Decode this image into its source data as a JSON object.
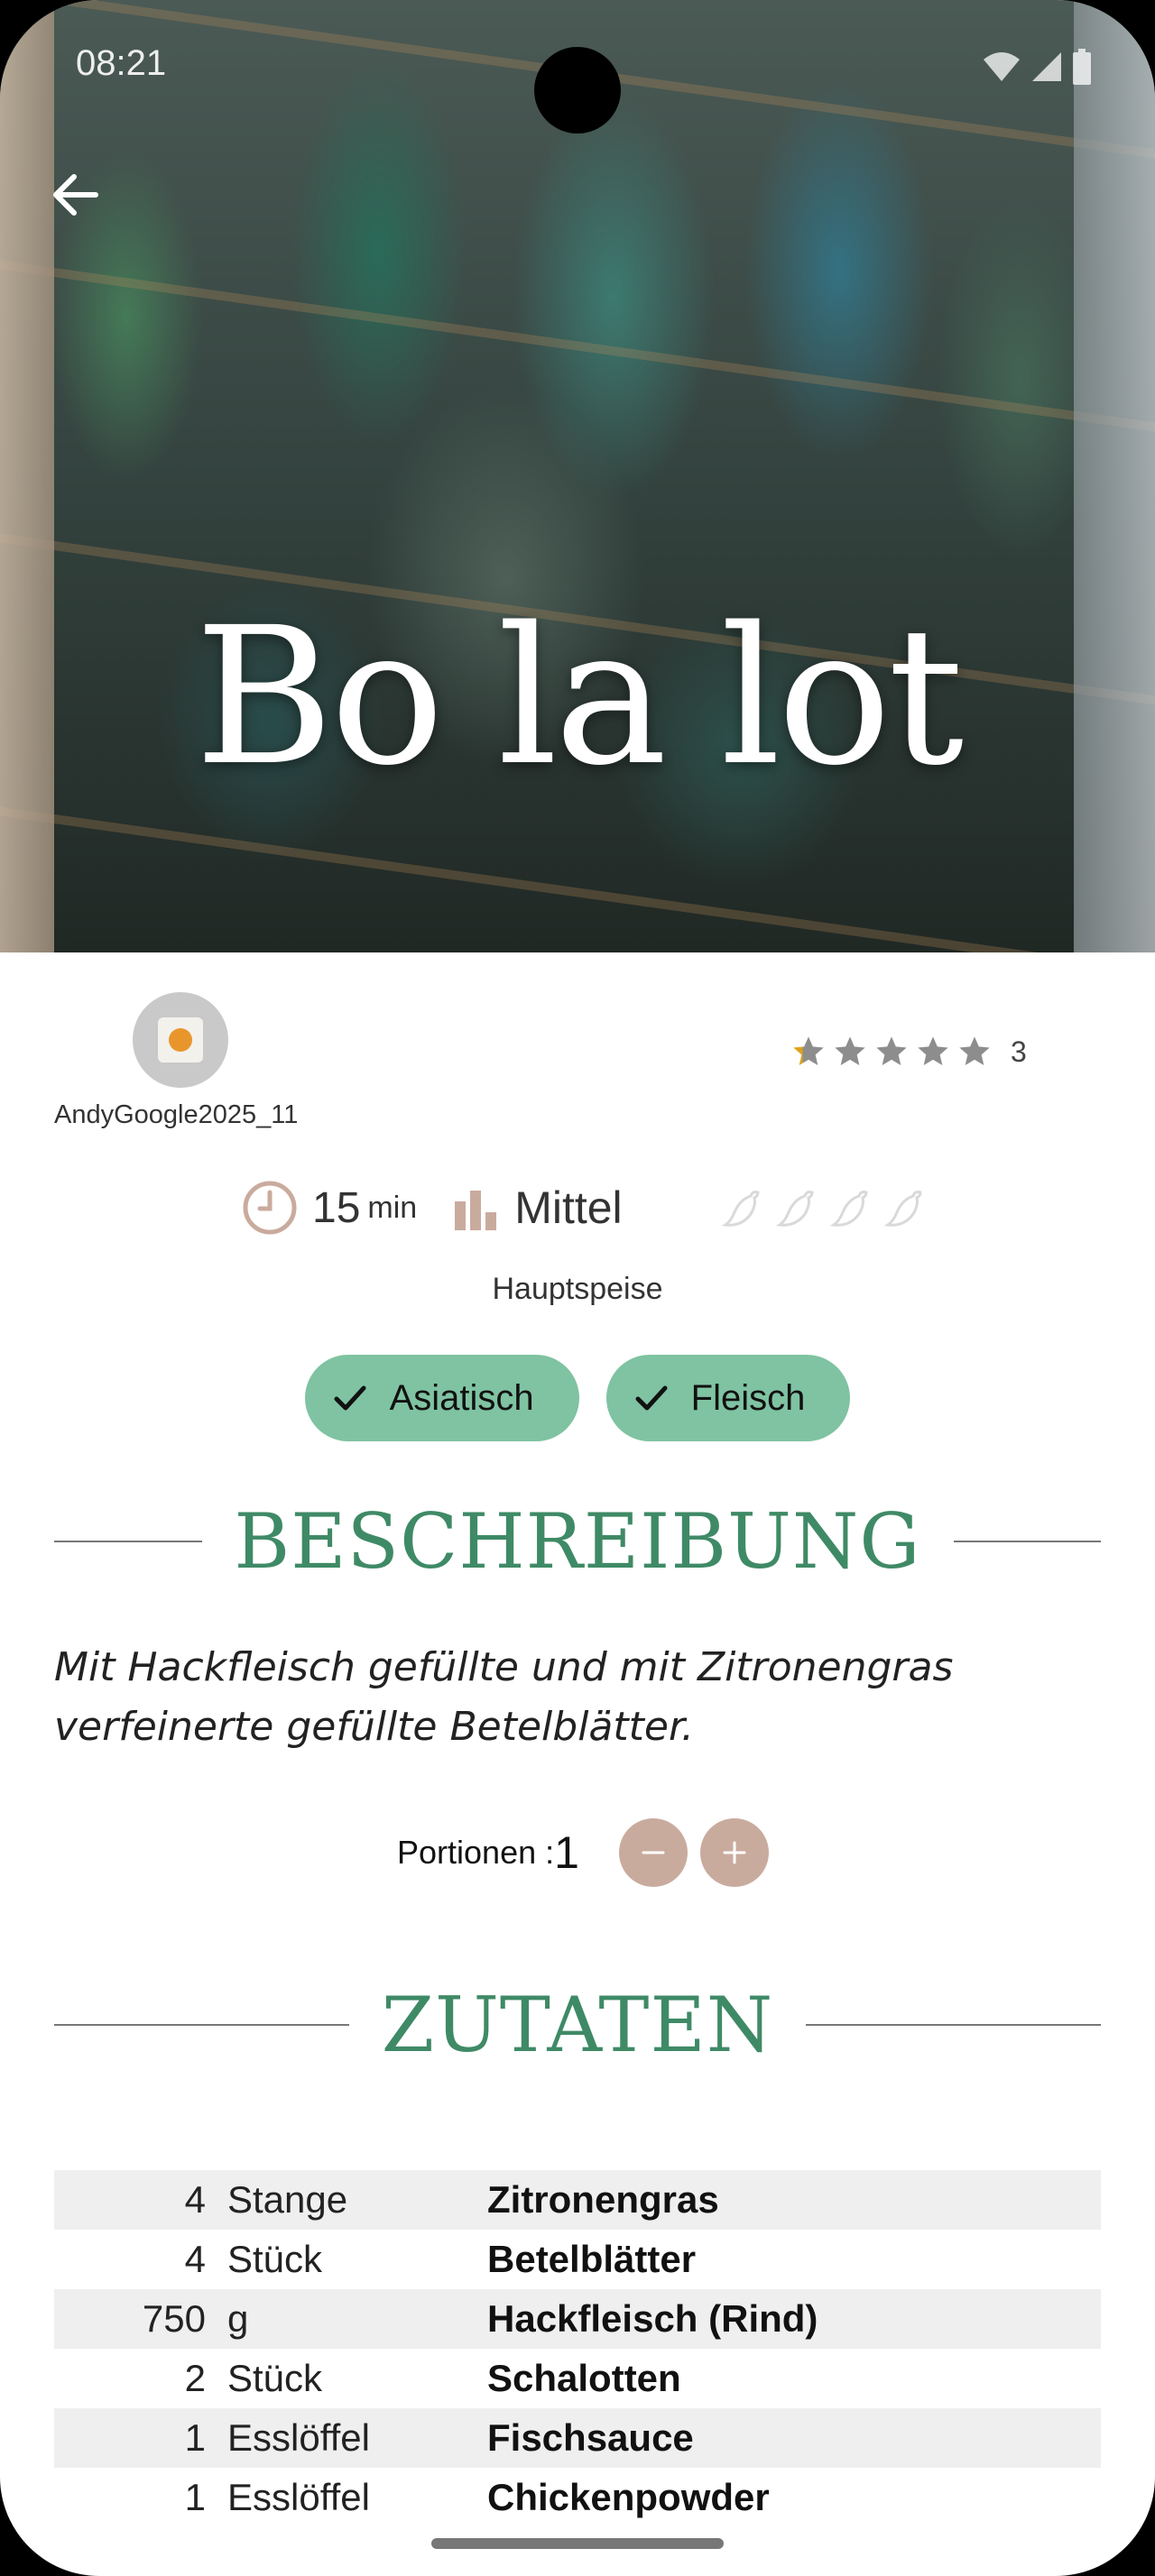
{
  "status_bar": {
    "time": "08:21"
  },
  "hero": {
    "title": "Bo la lot"
  },
  "author": {
    "name": "AndyGoogle2025_11"
  },
  "rating": {
    "stars_filled": 0.2,
    "stars_total": 5,
    "count": "3",
    "star_color": "#8d8d8d",
    "accent": "#e0a21b"
  },
  "meta": {
    "time_value": "15",
    "time_unit": "min",
    "difficulty": "Mittel",
    "spice_level": 0
  },
  "category": "Hauptspeise",
  "tags": [
    {
      "label": "Asiatisch"
    },
    {
      "label": "Fleisch"
    }
  ],
  "description": {
    "heading": "BESCHREIBUNG",
    "text": "Mit Hackfleisch gefüllte und mit Zitronengras verfeinerte gefüllte Betelblätter."
  },
  "portions": {
    "label": "Portionen :",
    "value": "1"
  },
  "ingredients": {
    "heading": "ZUTATEN",
    "rows": [
      {
        "qty": "4",
        "unit": "Stange",
        "name": "Zitronengras"
      },
      {
        "qty": "4",
        "unit": "Stück",
        "name": "Betelblätter"
      },
      {
        "qty": "750",
        "unit": "g",
        "name": "Hackfleisch (Rind)"
      },
      {
        "qty": "2",
        "unit": "Stück",
        "name": "Schalotten"
      },
      {
        "qty": "1",
        "unit": "Esslöffel",
        "name": "Fischsauce"
      },
      {
        "qty": "1",
        "unit": "Esslöffel",
        "name": "Chickenpowder"
      }
    ]
  },
  "colors": {
    "accent_green": "#3f8a66",
    "chip_green": "#7fc3a2",
    "button_brown": "#c9ab9e"
  }
}
